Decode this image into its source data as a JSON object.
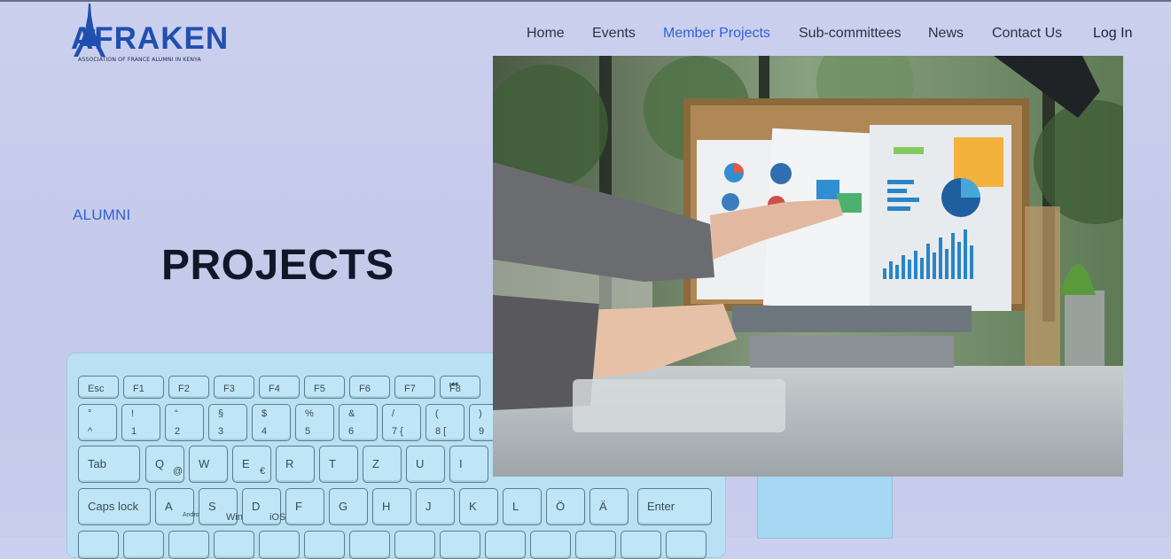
{
  "brand": {
    "name": "AFRAKEN",
    "tagline": "ASSOCIATION OF FRANCE ALUMNI IN KENYA",
    "color": "#1f4fb0"
  },
  "nav": {
    "items": [
      {
        "label": "Home",
        "active": false
      },
      {
        "label": "Events",
        "active": false
      },
      {
        "label": "Member Projects",
        "active": true
      },
      {
        "label": "Sub-committees",
        "active": false
      },
      {
        "label": "News",
        "active": false
      },
      {
        "label": "Contact Us",
        "active": false
      }
    ],
    "login": "Log In",
    "active_color": "#2f62d4"
  },
  "hero": {
    "eyebrow": "ALUMNI",
    "title": "PROJECTS"
  },
  "keyboard": {
    "row1": [
      {
        "top": "",
        "bottom": "Esc"
      },
      {
        "top": "",
        "bottom": "F1"
      },
      {
        "top": "",
        "bottom": "F2"
      },
      {
        "top": "",
        "bottom": "F3"
      },
      {
        "top": "",
        "bottom": "F4"
      },
      {
        "top": "",
        "bottom": "F5"
      },
      {
        "top": "",
        "bottom": "F6"
      },
      {
        "top": "",
        "bottom": "F7"
      },
      {
        "top": "⏮",
        "bottom": "F8"
      }
    ],
    "row2": [
      {
        "top": "°",
        "bottom": "^"
      },
      {
        "top": "!",
        "bottom": "1"
      },
      {
        "top": "“",
        "bottom": "2"
      },
      {
        "top": "§",
        "bottom": "3"
      },
      {
        "top": "$",
        "bottom": "4"
      },
      {
        "top": "%",
        "bottom": "5"
      },
      {
        "top": "&",
        "bottom": "6"
      },
      {
        "top": "/",
        "bottom": "7 {"
      },
      {
        "top": "(",
        "bottom": "8 ["
      },
      {
        "top": ")",
        "bottom": "9"
      }
    ],
    "row3": [
      {
        "top": "Tab",
        "bottom": ""
      },
      {
        "top": "Q",
        "bottom": "@"
      },
      {
        "top": "W",
        "bottom": ""
      },
      {
        "top": "E",
        "bottom": "€"
      },
      {
        "top": "R",
        "bottom": ""
      },
      {
        "top": "T",
        "bottom": ""
      },
      {
        "top": "Z",
        "bottom": ""
      },
      {
        "top": "U",
        "bottom": ""
      },
      {
        "top": "I",
        "bottom": ""
      }
    ],
    "row4": [
      {
        "top": "Caps lock",
        "bottom": ""
      },
      {
        "top": "A",
        "bottom": "Android"
      },
      {
        "top": "S",
        "bottom": "Win"
      },
      {
        "top": "D",
        "bottom": "iOS"
      },
      {
        "top": "F",
        "bottom": ""
      },
      {
        "top": "G",
        "bottom": ""
      },
      {
        "top": "H",
        "bottom": ""
      },
      {
        "top": "J",
        "bottom": ""
      },
      {
        "top": "K",
        "bottom": ""
      },
      {
        "top": "L",
        "bottom": ""
      },
      {
        "top": "Ö",
        "bottom": ""
      },
      {
        "top": "Ä",
        "bottom": ""
      },
      {
        "top": "Enter",
        "bottom": ""
      }
    ]
  },
  "photo": {
    "alt_icon": "photo-icon"
  }
}
